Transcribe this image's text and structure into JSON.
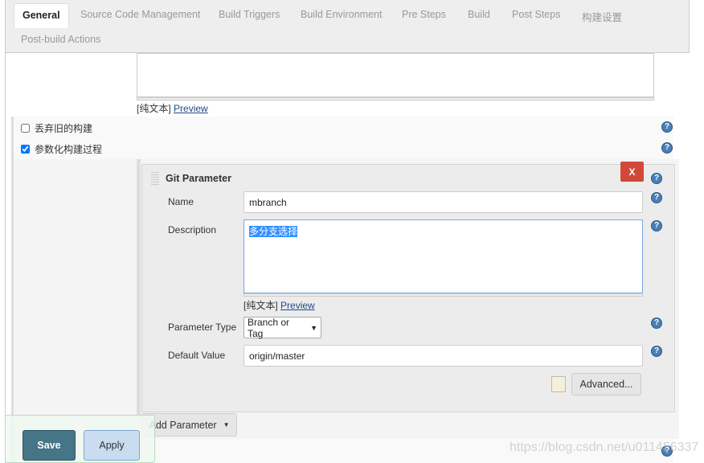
{
  "tabs": [
    {
      "label": "General"
    },
    {
      "label": "Source Code Management"
    },
    {
      "label": "Build Triggers"
    },
    {
      "label": "Build Environment"
    },
    {
      "label": "Pre Steps"
    },
    {
      "label": "Build"
    },
    {
      "label": "Post Steps"
    },
    {
      "label": "构建设置"
    },
    {
      "label": "Post-build Actions"
    }
  ],
  "top_editor": {
    "plain_text": "[纯文本]",
    "preview": "Preview"
  },
  "options": [
    {
      "label": "丢弃旧的构建",
      "checked": false
    },
    {
      "label": "参数化构建过程",
      "checked": true
    }
  ],
  "git_parameter": {
    "title": "Git Parameter",
    "delete_label": "X",
    "name_label": "Name",
    "name_value": "mbranch",
    "description_label": "Description",
    "description_value": "多分支选择",
    "plain_text": "[纯文本]",
    "preview": "Preview",
    "type_label": "Parameter Type",
    "type_value": "Branch or Tag",
    "default_label": "Default Value",
    "default_value": "origin/master",
    "advanced_label": "Advanced..."
  },
  "add_parameter": "Add Parameter",
  "save": "Save",
  "apply": "Apply",
  "watermark": "https://blog.csdn.net/u011456337",
  "colors": {
    "save_bg": "#467587",
    "apply_bg": "#c9dcf0",
    "delete_bg": "#d24939",
    "help": "#4a7fb5"
  }
}
